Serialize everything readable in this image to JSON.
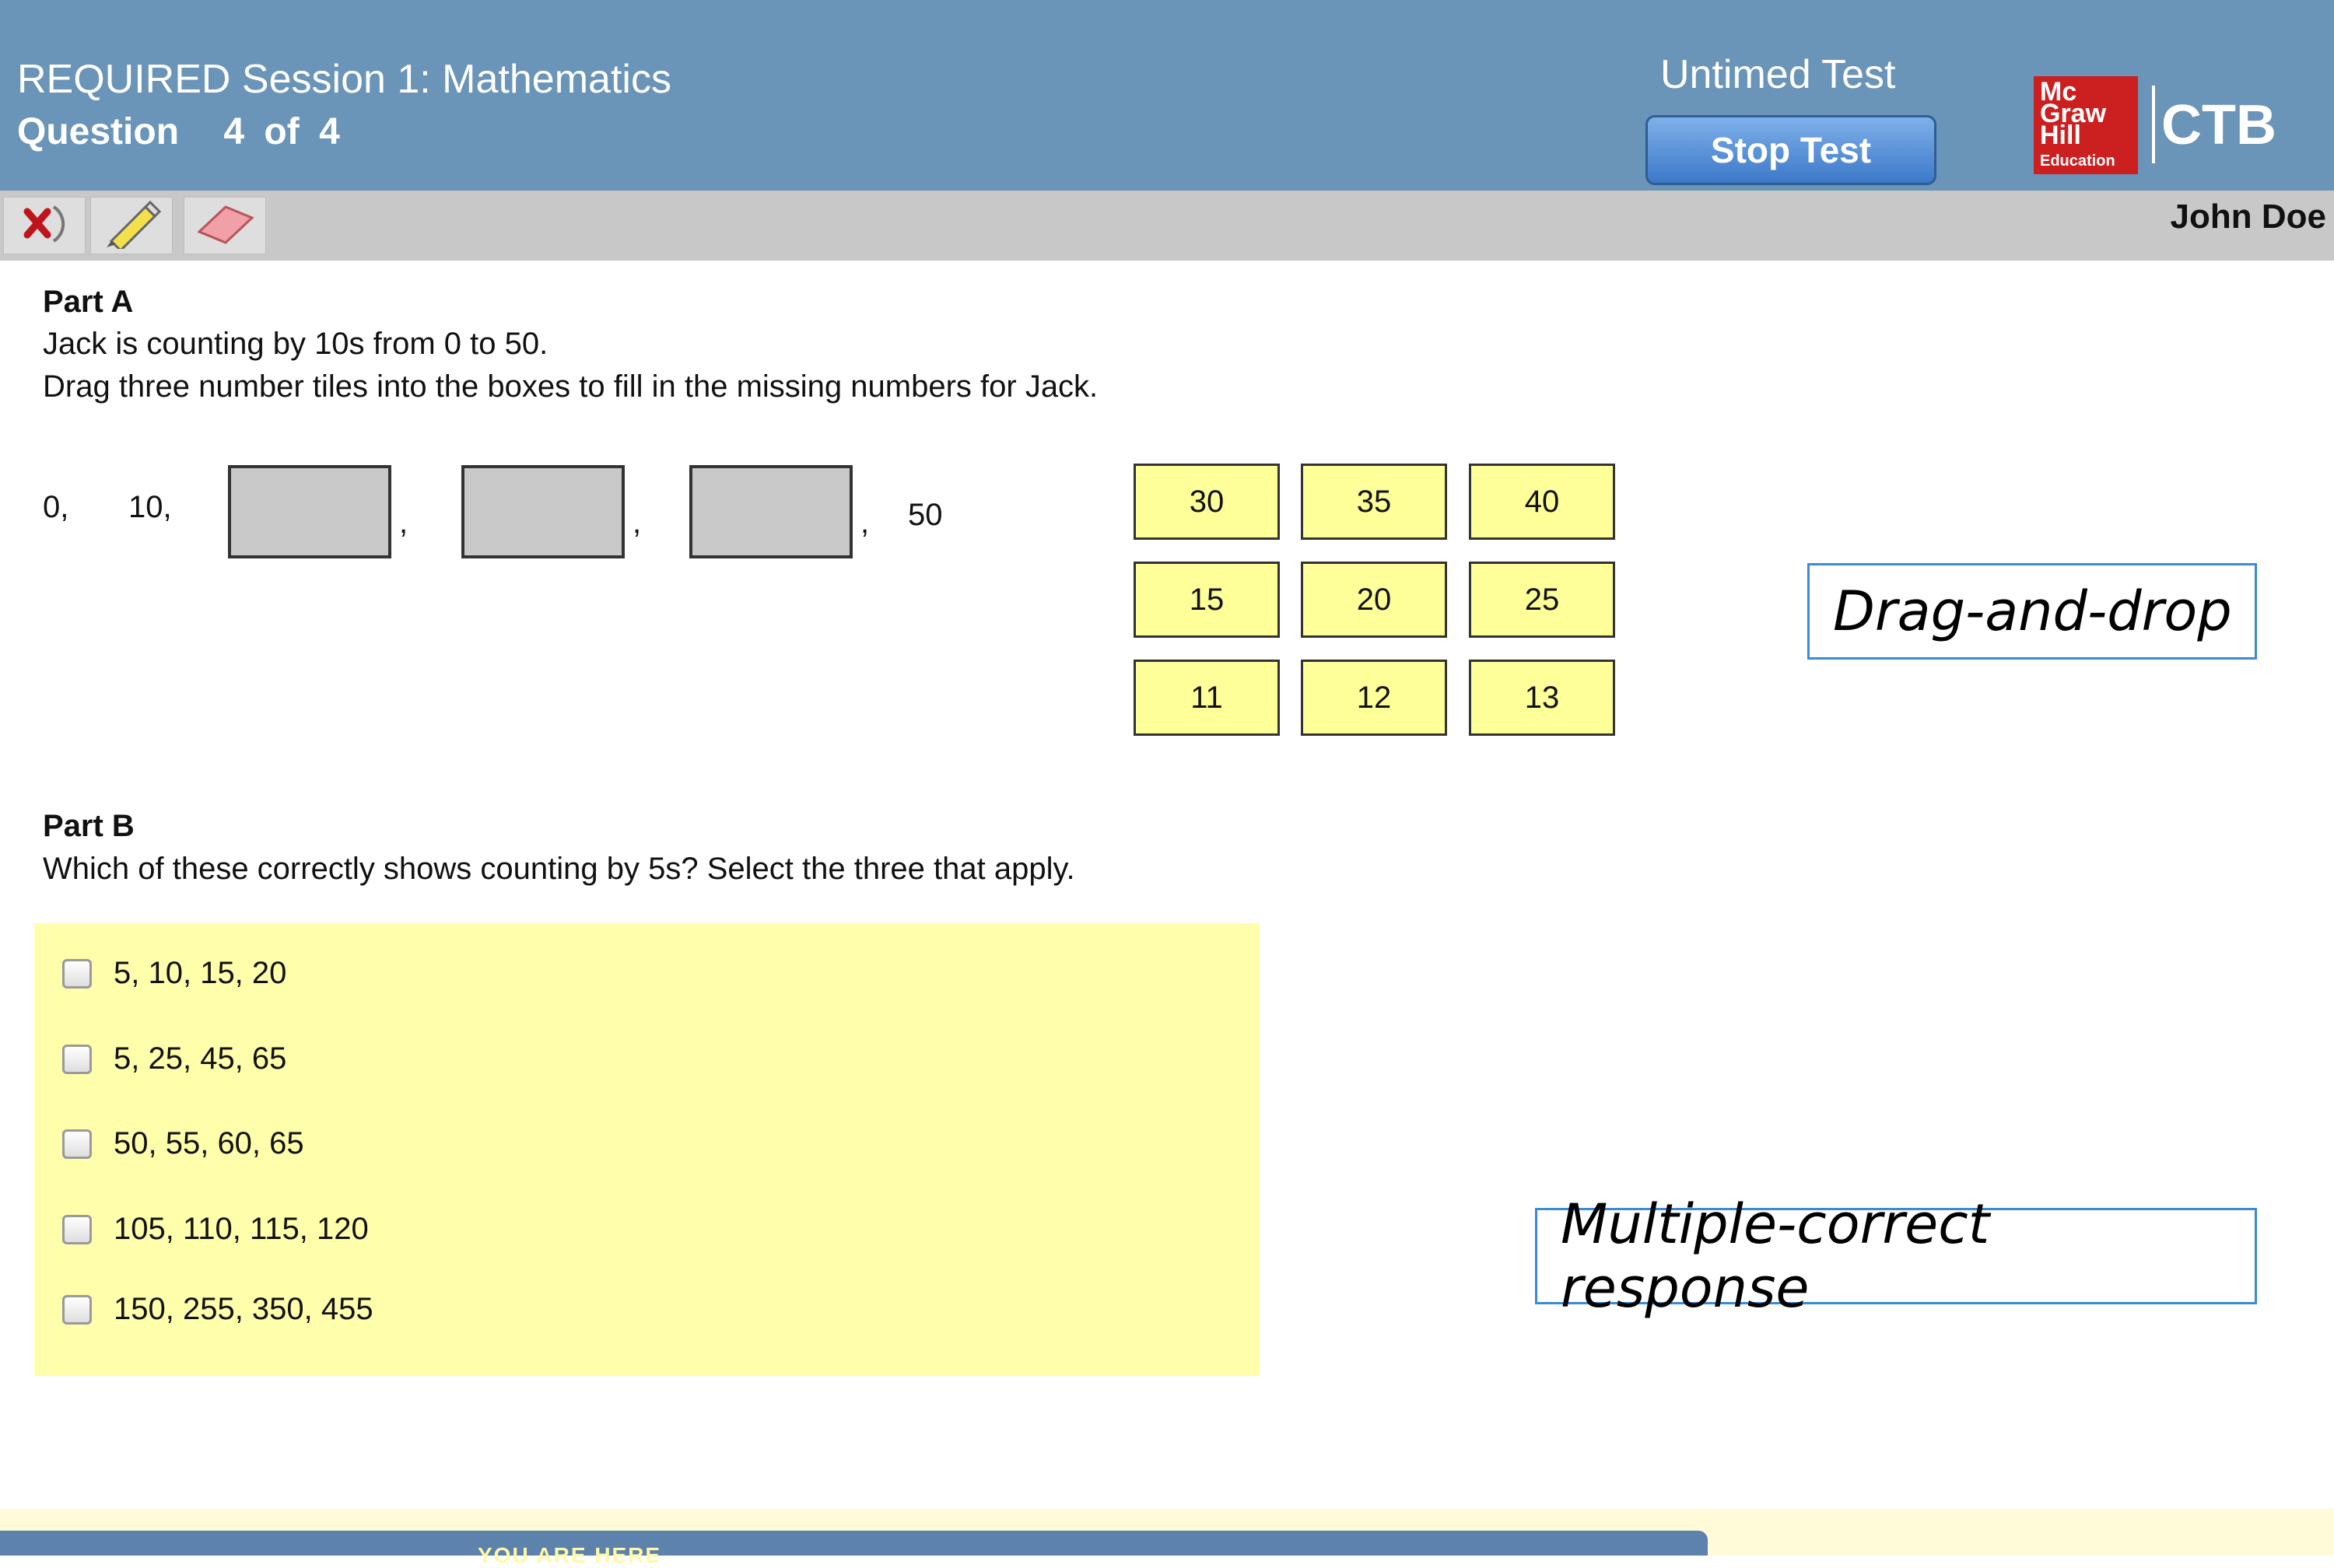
{
  "header": {
    "session_title": "REQUIRED Session 1: Mathematics",
    "question_label": "Question",
    "question_number": "4",
    "question_of": "of",
    "question_total": "4",
    "test_type": "Untimed Test",
    "stop_button_label": "Stop Test",
    "logo": {
      "mark": "McGraw Hill Education",
      "brand": "CTB",
      "brand_color": "#cc1f1f"
    }
  },
  "toolbar": {
    "tools": [
      {
        "name": "close-tool",
        "icon": "close-icon"
      },
      {
        "name": "highlighter-tool",
        "icon": "pencil-icon"
      },
      {
        "name": "eraser-tool",
        "icon": "eraser-icon"
      }
    ],
    "user_name": "John Doe"
  },
  "part_a": {
    "label": "Part A",
    "text_line_1": "Jack is counting by 10s from 0 to 50.",
    "text_line_2": "Drag three number tiles into the boxes to fill in the missing numbers for Jack.",
    "sequence_start": [
      "0,",
      "10,"
    ],
    "sequence_end": "50",
    "blank_count": 3,
    "tiles": [
      "30",
      "35",
      "40",
      "15",
      "20",
      "25",
      "11",
      "12",
      "13"
    ]
  },
  "part_b": {
    "label": "Part B",
    "text": "Which of these correctly shows counting by 5s? Select the three that apply.",
    "options": [
      {
        "text": "5, 10, 15, 20",
        "checked": false
      },
      {
        "text": "5, 25, 45, 65",
        "checked": false
      },
      {
        "text": "50, 55, 60, 65",
        "checked": false
      },
      {
        "text": "105, 110, 115, 120",
        "checked": false
      },
      {
        "text": "150, 255, 350, 455",
        "checked": false
      }
    ]
  },
  "annotations": {
    "drag_drop": "Drag-and-drop",
    "multiple_correct": "Multiple-correct response"
  },
  "footer": {
    "you_are_here": "YOU ARE HERE"
  },
  "colors": {
    "header_bg": "#6a94b8",
    "toolbar_bg": "#c8c8c8",
    "tile_bg": "#ffff99",
    "options_bg": "#ffffab",
    "callout_border": "#3a8ad6",
    "button_blue": "#3c79c8"
  }
}
